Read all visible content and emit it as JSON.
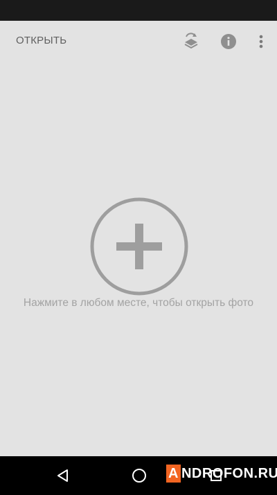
{
  "toolbar": {
    "open_label": "ОТКРЫТЬ",
    "icons": [
      "layers-rotate-icon",
      "info-icon",
      "more-vert-icon"
    ]
  },
  "main": {
    "add_icon": "plus-circle-icon",
    "hint": "Нажмите в любом месте, чтобы открыть фото"
  },
  "navigation": {
    "icons": [
      "back-icon",
      "home-icon",
      "recent-apps-icon"
    ]
  },
  "watermark": {
    "first_letter": "A",
    "rest": "NDROFON.RU"
  },
  "colors": {
    "background": "#e3e3e3",
    "icon_gray": "#9e9e9e",
    "label_gray": "#5f5f5f",
    "hint_gray": "#a3a3a3",
    "watermark_accent": "#f26522"
  }
}
